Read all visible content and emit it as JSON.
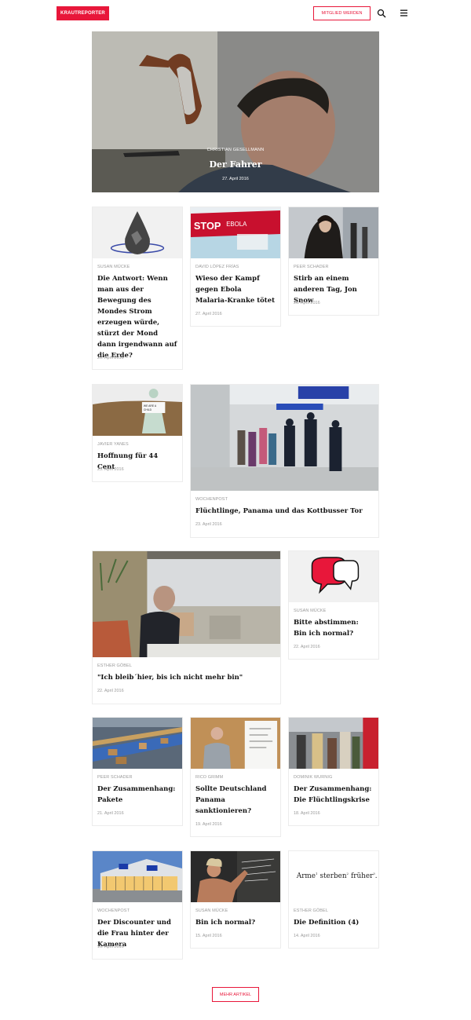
{
  "header": {
    "logo": "KRAUTREPORTER",
    "join_label": "MITGLIED WERDEN",
    "accent": "#e8173a"
  },
  "hero": {
    "author": "CHRISTIAN GESELLMANN",
    "title": "Der Fahrer",
    "date": "27. April 2016"
  },
  "articles": [
    {
      "author": "SUSAN MÜCKE",
      "title": "Die Antwort: Wenn man aus der Bewegung des Mondes Strom erzeugen würde, stürzt der Mond dann irgendwann auf die Erde?",
      "date": "20. April 2016"
    },
    {
      "author": "DAVID LÓPEZ FRÍAS",
      "title": "Wieso der Kampf gegen Ebola Malaria-Kranke tötet",
      "date": "27. April 2016"
    },
    {
      "author": "PEER SCHADER",
      "title": "Stirb an einem anderen Tag, Jon Snow",
      "date": "26. April 2016"
    },
    {
      "author": "JAVIER YANES",
      "title": "Hoffnung für 44 Cent",
      "date": "25. April 2016"
    },
    {
      "author": "WOCHENPOST",
      "title": "Flüchtlinge, Panama und das Kottbusser Tor",
      "date": "23. April 2016"
    },
    {
      "author": "ESTHER GÖBEL",
      "title": "\"Ich bleib´hier, bis ich nicht mehr bin\"",
      "date": "22. April 2016"
    },
    {
      "author": "SUSAN MÜCKE",
      "title": "Bitte abstimmen: Bin ich normal?",
      "date": "22. April 2016"
    },
    {
      "author": "PEER SCHADER",
      "title": "Der Zusammenhang: Pakete",
      "date": "21. April 2016"
    },
    {
      "author": "RICO GRIMM",
      "title": "Sollte Deutschland Panama sanktionieren?",
      "date": "19. April 2016"
    },
    {
      "author": "DOMINIK WURNIG",
      "title": "Der Zusammenhang: Die Flüchtlingskrise",
      "date": "18. April 2016"
    },
    {
      "author": "WOCHENPOST",
      "title": "Der Discounter und die Frau hinter der Kamera",
      "date": "16. April 2016"
    },
    {
      "author": "SUSAN MÜCKE",
      "title": "Bin ich normal?",
      "date": "15. April 2016"
    },
    {
      "author": "ESTHER GÖBEL",
      "title": "Die Definition (4)",
      "date": "14. April 2016"
    }
  ],
  "image_text": {
    "stop": "STOP",
    "ebola": "EBOLA",
    "doll_sign_1": "WE ARE A",
    "doll_sign_2": "CHILD",
    "arme": "Arme",
    "sterben": "sterben",
    "frueher": "früher",
    "sup1": "1",
    "sup2": "2",
    "sup3": "3"
  },
  "more_label": "MEHR ARTIKEL"
}
